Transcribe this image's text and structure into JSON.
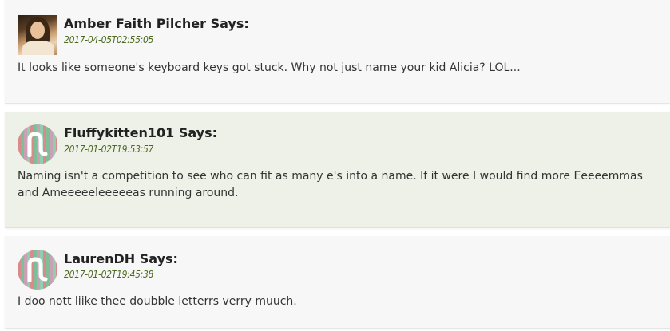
{
  "comments": [
    {
      "author": "Amber Faith Pilcher",
      "says": "Says:",
      "date": "2017-04-05T02:55:05",
      "text": "It looks like someone's keyboard keys got stuck. Why not just name your kid Alicia? LOL...",
      "avatar": "photo-avatar"
    },
    {
      "author": "Fluffykitten101",
      "says": "Says:",
      "date": "2017-01-02T19:53:57",
      "text": "Naming isn't a competition to see who can fit as many e's into a name. If it were I would find more Eeeeemmas and Ameeeeeleeeeeas running around.",
      "avatar": "generated-avatar"
    },
    {
      "author": "LaurenDH",
      "says": "Says:",
      "date": "2017-01-02T19:45:38",
      "text": "I doo nott liike thee doubble letterrs verry muuch.",
      "avatar": "generated-avatar"
    }
  ],
  "colors": {
    "date": "#4c6a1f",
    "highlight_background": "#eef1e8",
    "default_background": "#f7f7f7"
  }
}
